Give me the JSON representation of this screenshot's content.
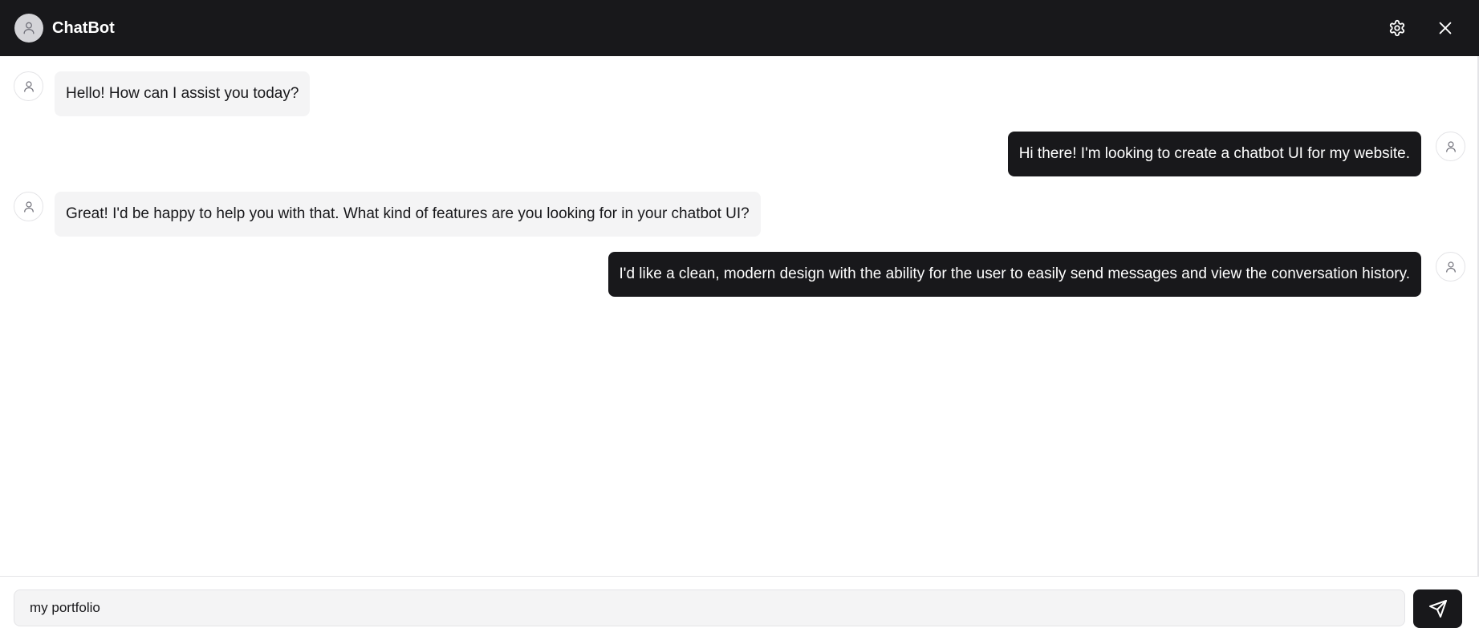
{
  "header": {
    "title": "ChatBot",
    "avatar_icon": "user-icon",
    "settings_icon": "gear-icon",
    "close_icon": "close-icon"
  },
  "messages": [
    {
      "role": "bot",
      "text": "Hello! How can I assist you today?"
    },
    {
      "role": "user",
      "text": "Hi there! I'm looking to create a chatbot UI for my website."
    },
    {
      "role": "bot",
      "text": "Great! I'd be happy to help you with that. What kind of features are you looking for in your chatbot UI?"
    },
    {
      "role": "user",
      "text": "I'd like a clean, modern design with the ability for the user to easily send messages and view the conversation history."
    }
  ],
  "composer": {
    "value": "my portfolio",
    "placeholder": "",
    "send_icon": "send-icon"
  },
  "colors": {
    "header_bg": "#18181b",
    "user_bubble": "#18181b",
    "bot_bubble": "#f4f4f5",
    "accent": "#18181b"
  }
}
